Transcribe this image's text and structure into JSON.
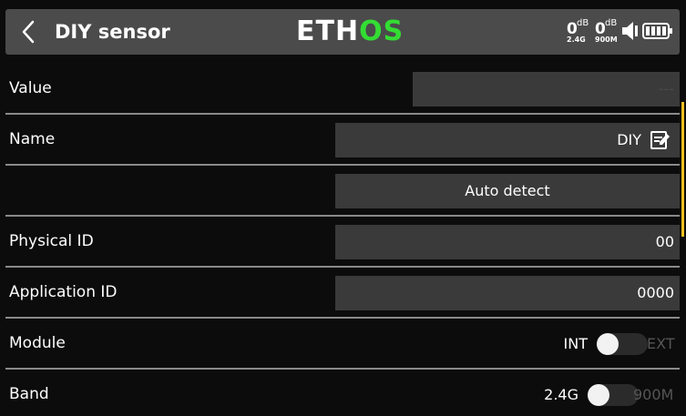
{
  "header": {
    "title": "DIY sensor",
    "logo": {
      "part1": "ETH",
      "part2": "OS"
    },
    "rssi": [
      {
        "value": "0",
        "unit": "dB",
        "band": "2.4G"
      },
      {
        "value": "0",
        "unit": "dB",
        "band": "900M"
      }
    ],
    "icons": [
      "back-icon",
      "speaker-icon",
      "battery-icon"
    ]
  },
  "rows": {
    "value": {
      "label": "Value",
      "display": "---"
    },
    "name": {
      "label": "Name",
      "value": "DIY"
    },
    "auto_detect": {
      "button_label": "Auto detect"
    },
    "physical_id": {
      "label": "Physical ID",
      "value": "00"
    },
    "application_id": {
      "label": "Application ID",
      "value": "0000"
    },
    "module": {
      "label": "Module",
      "left_option": "INT",
      "right_option": "EXT",
      "selected": "INT"
    },
    "band": {
      "label": "Band",
      "left_option": "2.4G",
      "right_option": "900M",
      "selected": "2.4G"
    }
  },
  "colors": {
    "background": "#0c0c0c",
    "title_bar": "#4b4b4b",
    "field": "#3a3a3a",
    "logo_accent": "#33dd33",
    "scrollbar": "#f0c020"
  }
}
